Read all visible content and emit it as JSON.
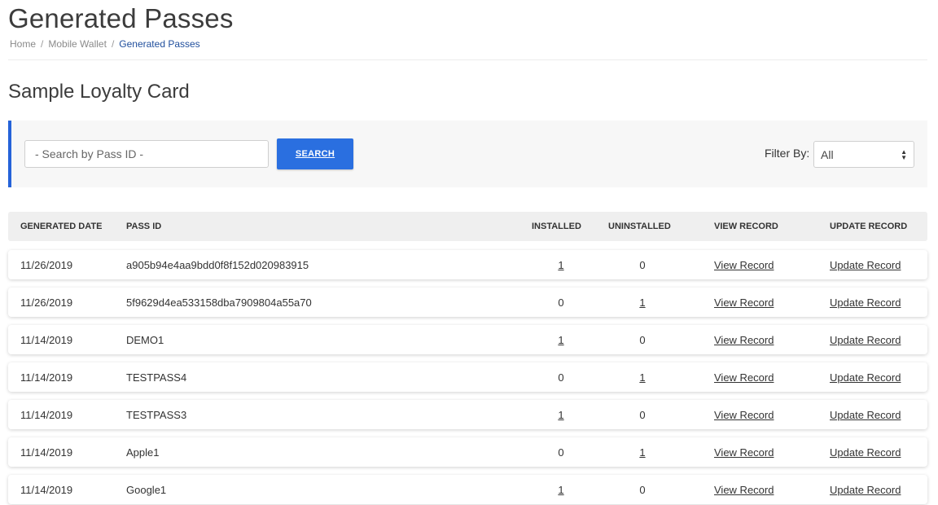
{
  "page": {
    "title": "Generated Passes"
  },
  "breadcrumb": {
    "home": "Home",
    "sep": "/",
    "mobile_wallet": "Mobile Wallet",
    "current": "Generated Passes"
  },
  "section": {
    "title": "Sample Loyalty Card"
  },
  "search": {
    "placeholder": "- Search by Pass ID -",
    "button_label": "SEARCH"
  },
  "filter": {
    "label": "Filter By:",
    "selected": "All"
  },
  "table": {
    "headers": {
      "date": "GENERATED DATE",
      "pass_id": "PASS ID",
      "installed": "INSTALLED",
      "uninstalled": "UNINSTALLED",
      "view": "VIEW RECORD",
      "update": "UPDATE RECORD"
    },
    "rows": [
      {
        "date": "11/26/2019",
        "pass_id": "a905b94e4aa9bdd0f8f152d020983915",
        "installed": "1",
        "uninstalled": "0",
        "view": "View Record",
        "update": "Update Record"
      },
      {
        "date": "11/26/2019",
        "pass_id": "5f9629d4ea533158dba7909804a55a70",
        "installed": "0",
        "uninstalled": "1",
        "view": "View Record",
        "update": "Update Record"
      },
      {
        "date": "11/14/2019",
        "pass_id": "DEMO1",
        "installed": "1",
        "uninstalled": "0",
        "view": "View Record",
        "update": "Update Record"
      },
      {
        "date": "11/14/2019",
        "pass_id": "TESTPASS4",
        "installed": "0",
        "uninstalled": "1",
        "view": "View Record",
        "update": "Update Record"
      },
      {
        "date": "11/14/2019",
        "pass_id": "TESTPASS3",
        "installed": "1",
        "uninstalled": "0",
        "view": "View Record",
        "update": "Update Record"
      },
      {
        "date": "11/14/2019",
        "pass_id": "Apple1",
        "installed": "0",
        "uninstalled": "1",
        "view": "View Record",
        "update": "Update Record"
      },
      {
        "date": "11/14/2019",
        "pass_id": "Google1",
        "installed": "1",
        "uninstalled": "0",
        "view": "View Record",
        "update": "Update Record"
      }
    ]
  },
  "colors": {
    "accent": "#2a6fe0",
    "breadcrumb_current": "#1f4e9c",
    "panel_bg": "#f7f7f7"
  }
}
